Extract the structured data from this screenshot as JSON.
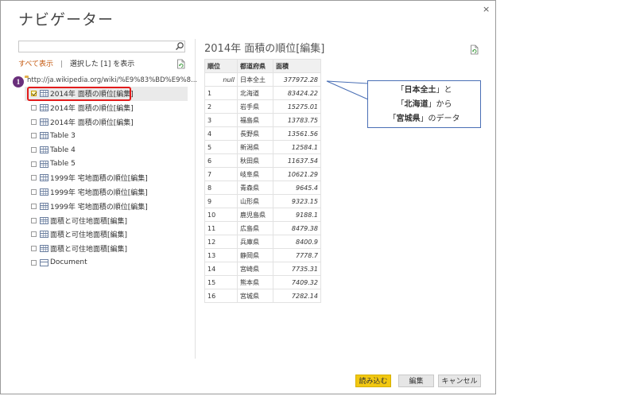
{
  "window": {
    "title": "ナビゲーター",
    "close": "×"
  },
  "search": {
    "value": "",
    "placeholder": ""
  },
  "links": {
    "show_all": "すべて表示",
    "separator": "|",
    "selected_only": "選択した [1] を表示"
  },
  "badge": {
    "number": "1"
  },
  "tree": {
    "root": "http://ja.wikipedia.org/wiki/%E9%83%BD%E9%8...",
    "items": [
      {
        "label": "2014年 面積の順位[編集]",
        "checked": true
      },
      {
        "label": "2014年 面積の順位[編集]"
      },
      {
        "label": "2014年 面積の順位[編集]"
      },
      {
        "label": "Table 3"
      },
      {
        "label": "Table 4"
      },
      {
        "label": "Table 5"
      },
      {
        "label": "1999年 宅地面積の順位[編集]"
      },
      {
        "label": "1999年 宅地面積の順位[編集]"
      },
      {
        "label": "1999年 宅地面積の順位[編集]"
      },
      {
        "label": "面積と可住地面積[編集]"
      },
      {
        "label": "面積と可住地面積[編集]"
      },
      {
        "label": "面積と可住地面積[編集]"
      },
      {
        "label": "Document"
      }
    ]
  },
  "preview": {
    "title": "2014年 面積の順位[編集]",
    "headers": [
      "順位",
      "都道府県",
      "面積"
    ],
    "rows": [
      [
        "null",
        "日本全土",
        "377972.28"
      ],
      [
        "1",
        "北海道",
        "83424.22"
      ],
      [
        "2",
        "岩手県",
        "15275.01"
      ],
      [
        "3",
        "福島県",
        "13783.75"
      ],
      [
        "4",
        "長野県",
        "13561.56"
      ],
      [
        "5",
        "新潟県",
        "12584.1"
      ],
      [
        "6",
        "秋田県",
        "11637.54"
      ],
      [
        "7",
        "岐阜県",
        "10621.29"
      ],
      [
        "8",
        "青森県",
        "9645.4"
      ],
      [
        "9",
        "山形県",
        "9323.15"
      ],
      [
        "10",
        "鹿児島県",
        "9188.1"
      ],
      [
        "11",
        "広島県",
        "8479.38"
      ],
      [
        "12",
        "兵庫県",
        "8400.9"
      ],
      [
        "13",
        "静岡県",
        "7778.7"
      ],
      [
        "14",
        "宮崎県",
        "7735.31"
      ],
      [
        "15",
        "熊本県",
        "7409.32"
      ],
      [
        "16",
        "宮城県",
        "7282.14"
      ]
    ]
  },
  "callout": {
    "line1_a": "「",
    "line1_b": "日本全土",
    "line1_c": "」と",
    "line2_a": "「",
    "line2_b": "北海道",
    "line2_c": "」から",
    "line3_a": "「",
    "line3_b": "宮城県",
    "line3_c": "」のデータ"
  },
  "buttons": {
    "load": "読み込む",
    "edit": "編集",
    "cancel": "キャンセル"
  },
  "colors": {
    "accent": "#f2c811",
    "link": "#c55a11",
    "highlight": "#e21b1b",
    "badge": "#6a2f7b",
    "callout_border": "#4a6fb5"
  }
}
